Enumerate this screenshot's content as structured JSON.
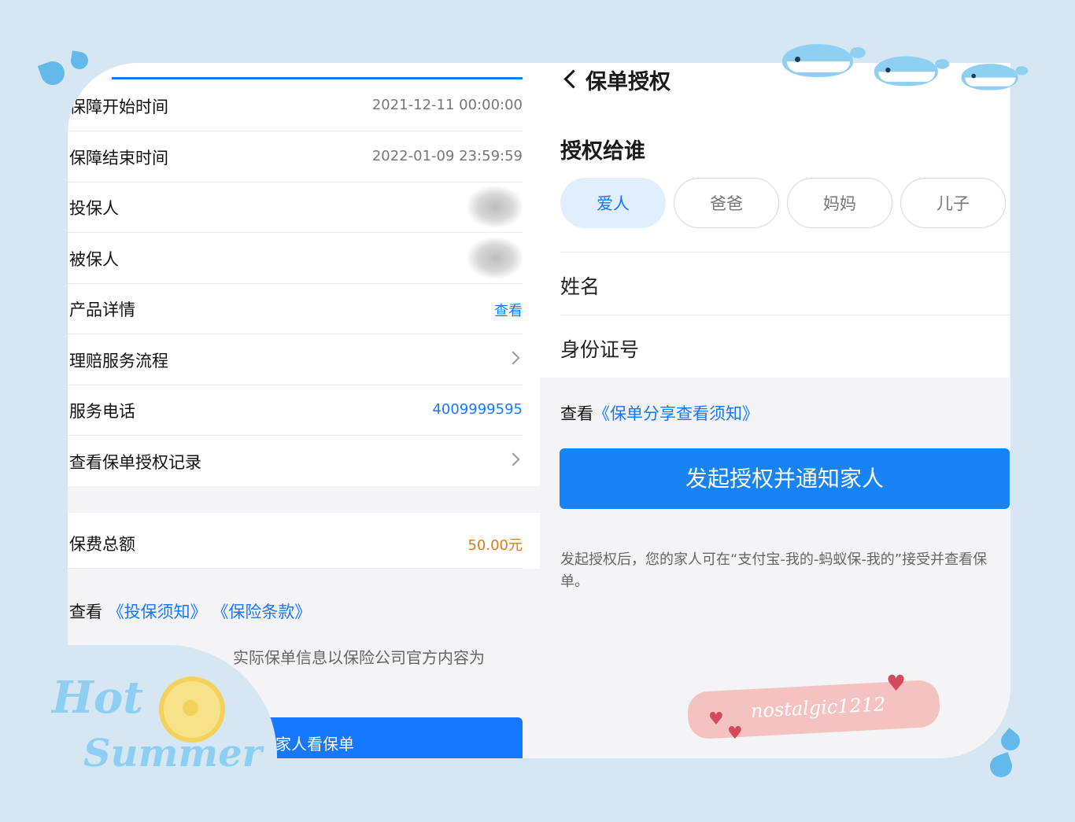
{
  "left_panel": {
    "rows": [
      {
        "label": "保障开始时间",
        "value": "2021-12-11 00:00:00"
      },
      {
        "label": "保障结束时间",
        "value": "2022-01-09 23:59:59"
      },
      {
        "label": "投保人",
        "value": ""
      },
      {
        "label": "被保人",
        "value": ""
      },
      {
        "label": "产品详情",
        "value": "查看"
      },
      {
        "label": "理赔服务流程",
        "value": ""
      },
      {
        "label": "服务电话",
        "value": "4009999595"
      },
      {
        "label": "查看保单授权记录",
        "value": ""
      }
    ],
    "premium": {
      "label": "保费总额",
      "value": "50.00元"
    },
    "notes": {
      "prefix": "查看",
      "link1": "《投保须知》",
      "link2": "《保险条款》"
    },
    "disclaimer": "实际保单信息以保险公司官方内容为",
    "button_label": "家人看保单"
  },
  "right_panel": {
    "title": "保单授权",
    "section_title": "授权给谁",
    "chips": [
      {
        "label": "爱人",
        "active": true
      },
      {
        "label": "爸爸",
        "active": false
      },
      {
        "label": "妈妈",
        "active": false
      },
      {
        "label": "儿子",
        "active": false
      }
    ],
    "fields": [
      {
        "label": "姓名"
      },
      {
        "label": "身份证号"
      }
    ],
    "note_prefix": "查看",
    "note_link": "《保单分享查看须知》",
    "button_label": "发起授权并通知家人",
    "description": "发起授权后，您的家人可在“支付宝-我的-蚂蚁保-我的”接受并查看保单。"
  },
  "decorations": {
    "sticker_line1": "Hot",
    "sticker_line2": "Summer",
    "signature": "nostalgic1212"
  },
  "colors": {
    "accent": "#1677ff",
    "orange": "#e07a16",
    "background": "#d6e6f3"
  }
}
